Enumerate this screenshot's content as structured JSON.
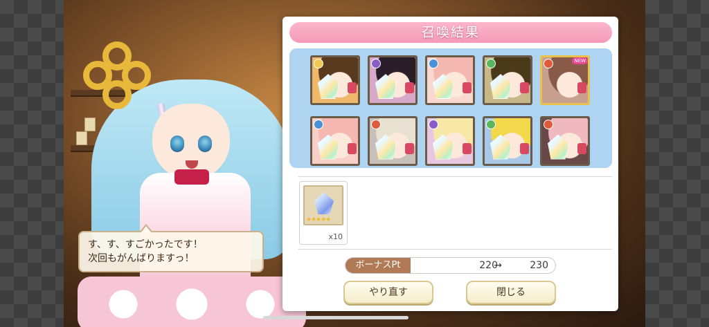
{
  "dialog": {
    "title": "召喚結果"
  },
  "results": [
    {
      "element": "light",
      "element_color": "#f2c94c",
      "is_new": false,
      "frame": "normal",
      "hair": "#5a3a1e",
      "bg": "#f0b86a"
    },
    {
      "element": "dark",
      "element_color": "#8a5cc8",
      "is_new": false,
      "frame": "normal",
      "hair": "#2a1e2a",
      "bg": "#d8a8c8"
    },
    {
      "element": "water",
      "element_color": "#4a90d8",
      "is_new": false,
      "frame": "normal",
      "hair": "#f5b8b0",
      "bg": "#f8d8d0"
    },
    {
      "element": "wind",
      "element_color": "#5ab85a",
      "is_new": false,
      "frame": "normal",
      "hair": "#4a3a1a",
      "bg": "#c8b888"
    },
    {
      "element": "fire",
      "element_color": "#e05a3a",
      "is_new": true,
      "new_label": "NEW",
      "frame": "gold",
      "hair": "#8a5a48",
      "bg": "#c8a090"
    },
    {
      "element": "water",
      "element_color": "#4a90d8",
      "is_new": false,
      "frame": "normal",
      "hair": "#f5b8b0",
      "bg": "#f8d0c8"
    },
    {
      "element": "fire",
      "element_color": "#e05a3a",
      "is_new": false,
      "frame": "normal",
      "hair": "#e8e0d0",
      "bg": "#c8c0b8"
    },
    {
      "element": "dark",
      "element_color": "#8a5cc8",
      "is_new": false,
      "frame": "normal",
      "hair": "#f8e8a8",
      "bg": "#e8c8e0"
    },
    {
      "element": "wind",
      "element_color": "#5ab85a",
      "is_new": false,
      "frame": "normal",
      "hair": "#f2d84a",
      "bg": "#a8c8e8"
    },
    {
      "element": "fire",
      "element_color": "#e05a3a",
      "is_new": false,
      "frame": "normal",
      "hair": "#f0b8c0",
      "bg": "#684848"
    }
  ],
  "bonus_item": {
    "icon": "crystal-icon",
    "stars": "★★★★★",
    "count": "x10"
  },
  "bonus_pt": {
    "label": "ボーナスPt",
    "from": "220",
    "arrow": "→",
    "to": "230"
  },
  "buttons": {
    "retry": "やり直す",
    "close": "閉じる"
  },
  "speech": {
    "line1": "す、す、すごかったです！",
    "line2": "次回もがんばりますっ！"
  },
  "colors": {
    "title_pink": "#f59ab8",
    "results_blue": "#aed4f2",
    "pt_label_brown": "#b07a56",
    "button_cream": "#f5ecc8"
  }
}
